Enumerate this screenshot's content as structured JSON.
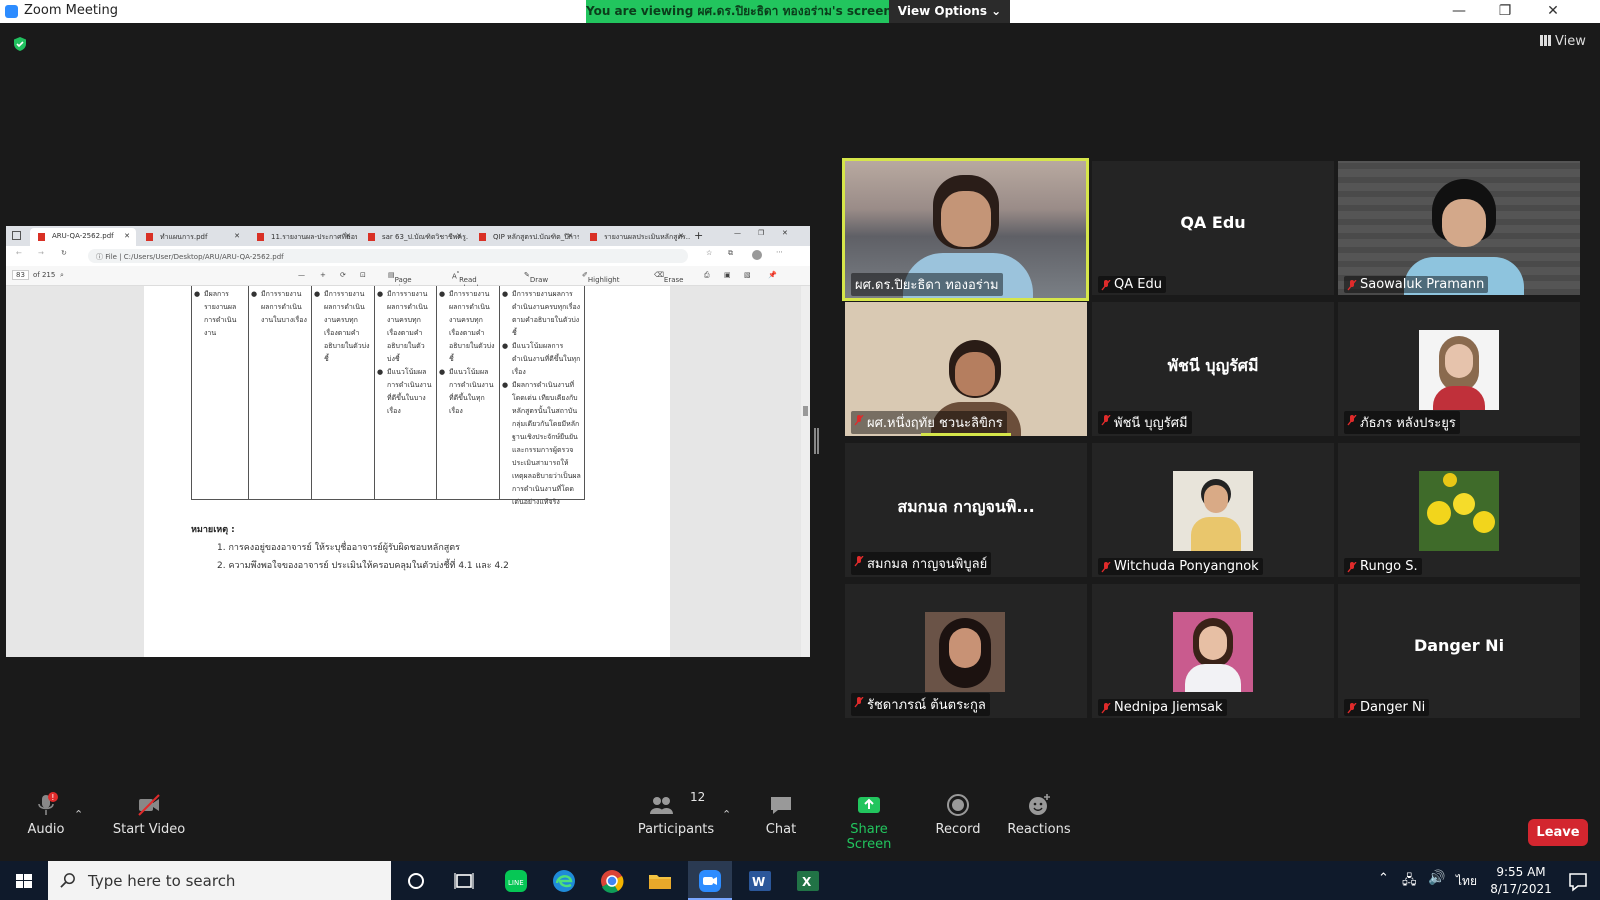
{
  "window": {
    "title": "Zoom Meeting",
    "banner_prefix": "You are viewing ",
    "banner_name": "ผศ.ดร.ปิยะธิดา ทองอร่าม",
    "banner_suffix": "'s screen",
    "view_options": "View Options ⌄",
    "view_label": "View",
    "min": "—",
    "max": "❐",
    "close": "✕"
  },
  "shared_screen": {
    "tabs": [
      {
        "label": "ARU-QA-2562.pdf",
        "active": true
      },
      {
        "label": "ทำแผนการ.pdf",
        "active": false
      },
      {
        "label": "11.รายงานผล-ประกาศที่มอบ...",
        "active": false
      },
      {
        "label": "sar 63_ป.บัณฑิตวิชาชีพครู.pdf",
        "active": false
      },
      {
        "label": "QIP หลักสูตรป.บัณฑิต_ปีการศึ...",
        "active": false
      },
      {
        "label": "รายงานผลประเมินหลักสูตร...",
        "active": false
      }
    ],
    "url_prefix": "File",
    "url": "C:/Users/User/Desktop/ARU/ARU-QA-2562.pdf",
    "page_number": "83",
    "page_total": "of 215",
    "toolbar": {
      "page_view": "Page view",
      "read_aloud": "Read aloud",
      "draw": "Draw",
      "highlight": "Highlight",
      "erase": "Erase"
    },
    "table_columns": [
      [
        "มีผลการรายงานผลการดำเนินงาน"
      ],
      [
        "มีการรายงานผลการดำเนินงานในบางเรื่อง"
      ],
      [
        "มีการรายงานผลการดำเนินงานครบทุกเรื่องตามคำอธิบายในตัวบ่งชี้"
      ],
      [
        "มีการรายงานผลการดำเนินงานครบทุกเรื่องตามคำอธิบายในตัวบ่งชี้",
        "มีแนวโน้มผลการดำเนินงานที่ดีขึ้นในบางเรื่อง"
      ],
      [
        "มีการรายงานผลการดำเนินงานครบทุกเรื่องตามคำอธิบายในตัวบ่งชี้",
        "มีแนวโน้มผลการดำเนินงานที่ดีขึ้นในทุกเรื่อง"
      ],
      [
        "มีการรายงานผลการดำเนินงานครบทุกเรื่องตามคำอธิบายในตัวบ่งชี้",
        "มีแนวโน้มผลการดำเนินงานที่ดีขึ้นในทุกเรื่อง",
        "มีผลการดำเนินงานที่โดดเด่น เทียบเคียงกับหลักสูตรนั้นในสถาบันกลุ่มเดียวกันโดยมีหลักฐานเชิงประจักษ์ยืนยัน และกรรมการผู้ตรวจประเมินสามารถให้เหตุผลอธิบายว่าเป็นผลการดำเนินงานที่โดดเด่นอย่างแท้จริง"
      ]
    ],
    "note_title": "หมายเหตุ :",
    "notes": [
      "1. การคงอยู่ของอาจารย์ ให้ระบุชื่ออาจารย์ผู้รับผิดชอบหลักสูตร",
      "2. ความพึงพอใจของอาจารย์ ประเมินให้ครอบคลุมในตัวบ่งชี้ที่ 4.1 และ 4.2"
    ]
  },
  "participants": [
    {
      "name": "ผศ.ดร.ปิยะธิดา ทองอร่าม",
      "video": true,
      "active": true,
      "muted": false
    },
    {
      "name": "QA Edu",
      "display": "QA Edu",
      "video": false,
      "muted": true
    },
    {
      "name": "Saowaluk Pramann",
      "video": true,
      "muted": true
    },
    {
      "name": "ผศ.หนึ่งฤทัย ชวนะลิขิกร",
      "video": true,
      "muted": true
    },
    {
      "name": "พัชนี บุญรัศมี",
      "display": "พัชนี บุญรัศมี",
      "video": false,
      "muted": true
    },
    {
      "name": "ภัธภร หลังประยูร",
      "video": true,
      "muted": true
    },
    {
      "name": "สมกมล กาญจนพิบูลย์",
      "display": "สมกมล กาญจนพิ...",
      "video": false,
      "muted": true
    },
    {
      "name": "Witchuda Ponyangnok",
      "video": true,
      "muted": true
    },
    {
      "name": "Rungo S.",
      "video": true,
      "muted": true
    },
    {
      "name": "รัชดาภรณ์ ต้นตระกูล",
      "video": true,
      "muted": true
    },
    {
      "name": "Nednipa Jiemsak",
      "video": true,
      "muted": true
    },
    {
      "name": "Danger Ni",
      "display": "Danger Ni",
      "video": false,
      "muted": true
    }
  ],
  "controls": {
    "audio": "Audio",
    "start_video": "Start Video",
    "participants": "Participants",
    "participant_count": "12",
    "chat": "Chat",
    "share_screen": "Share Screen",
    "record": "Record",
    "reactions": "Reactions",
    "leave": "Leave"
  },
  "taskbar": {
    "search_placeholder": "Type here to search",
    "time": "9:55 AM",
    "date": "8/17/2021",
    "lang": "ไทย"
  },
  "colors": {
    "banner": "#22c55e",
    "active_speaker": "#d6e64a",
    "share_green": "#22c55e",
    "leave": "#d3262f",
    "muted": "#e02b2b"
  }
}
